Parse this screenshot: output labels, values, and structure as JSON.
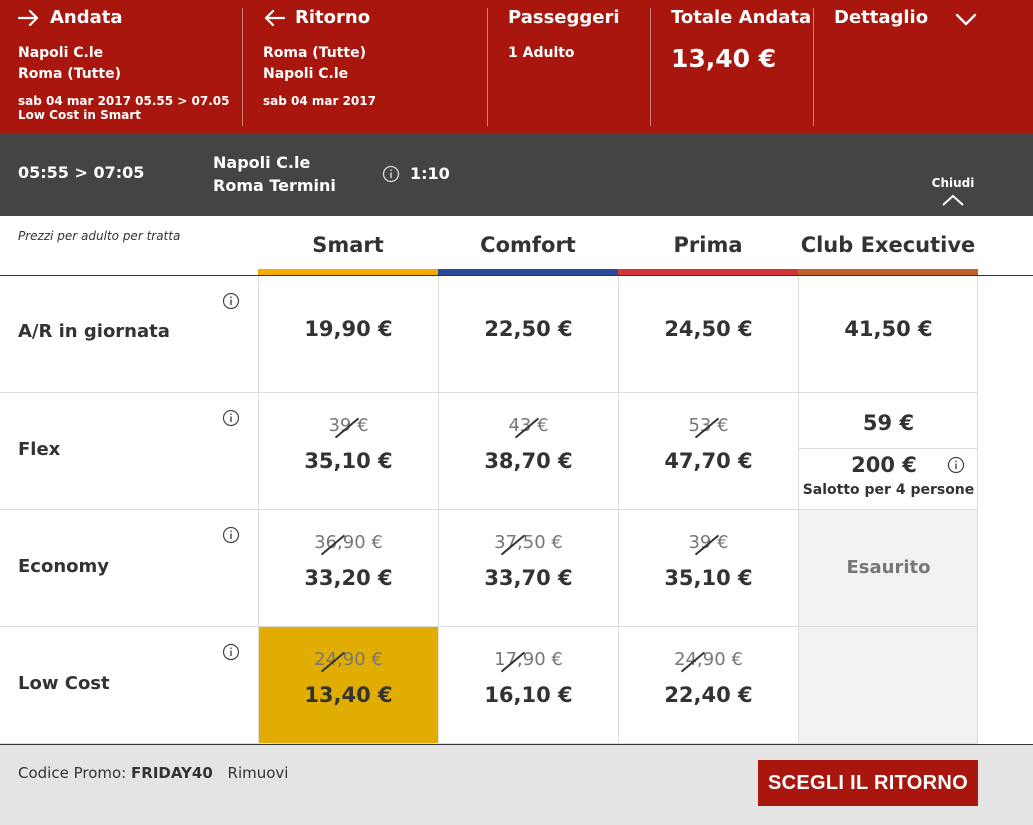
{
  "header": {
    "outbound": {
      "title": "Andata",
      "from": "Napoli C.le",
      "to": "Roma (Tutte)",
      "datetime": "sab 04 mar 2017 05.55 > 07.05",
      "offer": "Low Cost in Smart"
    },
    "return": {
      "title": "Ritorno",
      "from": "Roma (Tutte)",
      "to": "Napoli C.le",
      "date": "sab 04 mar 2017"
    },
    "passengers": {
      "title": "Passeggeri",
      "value": "1 Adulto"
    },
    "total": {
      "title": "Totale Andata",
      "value": "13,40 €"
    },
    "detail": {
      "title": "Dettaglio"
    }
  },
  "journey": {
    "times": "05:55 > 07:05",
    "from": "Napoli C.le",
    "to": "Roma Termini",
    "duration": "1:10",
    "close_label": "Chiudi"
  },
  "grid": {
    "note": "Prezzi per adulto per tratta",
    "columns": [
      {
        "label": "Smart",
        "color": "#f5ab00"
      },
      {
        "label": "Comfort",
        "color": "#2a4a9a"
      },
      {
        "label": "Prima",
        "color": "#d1343a"
      },
      {
        "label": "Club Executive",
        "color": "#c0632a"
      }
    ],
    "rows": [
      {
        "label": "A/R in giornata",
        "cells": [
          {
            "price": "19,90 €"
          },
          {
            "price": "22,50 €"
          },
          {
            "price": "24,50 €"
          },
          {
            "price": "41,50 €"
          }
        ]
      },
      {
        "label": "Flex",
        "cells": [
          {
            "old": "39 €",
            "price": "35,10 €"
          },
          {
            "old": "43 €",
            "price": "38,70 €"
          },
          {
            "old": "53 €",
            "price": "47,70 €"
          },
          {
            "price_top": "59 €",
            "price_bottom": "200 €",
            "desc": "Salotto per 4 persone"
          }
        ]
      },
      {
        "label": "Economy",
        "cells": [
          {
            "old": "36,90 €",
            "price": "33,20 €"
          },
          {
            "old": "37,50 €",
            "price": "33,70 €"
          },
          {
            "old": "39 €",
            "price": "35,10 €"
          },
          {
            "status": "Esaurito"
          }
        ]
      },
      {
        "label": "Low Cost",
        "cells": [
          {
            "old": "24,90 €",
            "price": "13,40 €",
            "selected": true
          },
          {
            "old": "17,90 €",
            "price": "16,10 €"
          },
          {
            "old": "24,90 €",
            "price": "22,40 €"
          },
          {
            "status": ""
          }
        ]
      }
    ]
  },
  "footer": {
    "promo_label": "Codice Promo:",
    "promo_code": "FRIDAY40",
    "remove_label": "Rimuovi",
    "cta_label": "SCEGLI IL RITORNO"
  },
  "icons": {
    "outbound": "arrow-right-icon",
    "return": "arrow-left-icon",
    "detail": "chevron-down-icon",
    "info": "info-circle-icon",
    "close": "chevron-up-icon"
  },
  "colors": {
    "brand_red": "#a8160e",
    "dark_bar": "#444444",
    "selected": "#e0ad00"
  }
}
